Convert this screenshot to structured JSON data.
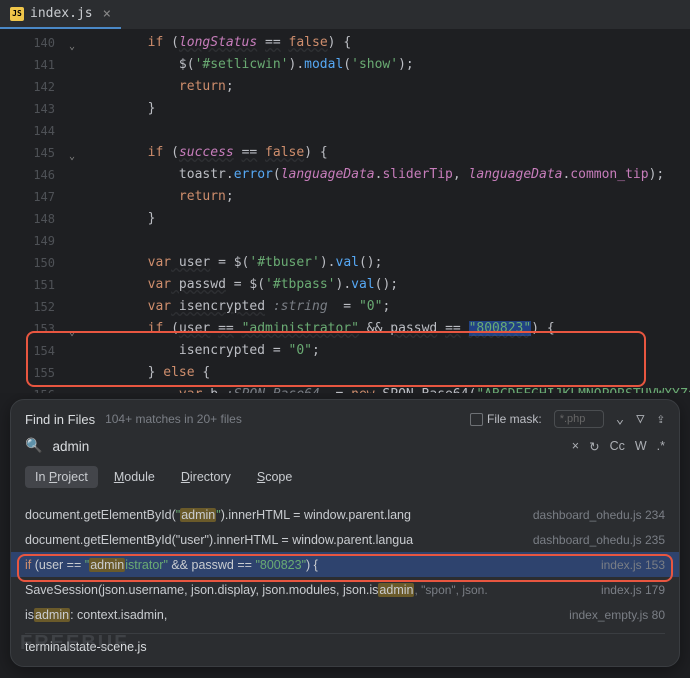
{
  "tab": {
    "icon": "JS",
    "name": "index.js",
    "close": "×"
  },
  "gutter": [
    "140",
    "141",
    "142",
    "143",
    "144",
    "145",
    "146",
    "147",
    "148",
    "149",
    "150",
    "151",
    "152",
    "153",
    "154",
    "155",
    "156"
  ],
  "code": {
    "l140": {
      "pre": "        ",
      "kw": "if",
      "mid": " (",
      "v1": "longStatus",
      "eq": "==",
      "v2": "false",
      "end": ") {"
    },
    "l141": {
      "pre": "            $(",
      "s": "'#setlicwin'",
      "mid": ").",
      "fn": "modal",
      "a": "(",
      "s2": "'show'",
      "end": ");"
    },
    "l142": {
      "pre": "            ",
      "kw": "return",
      "end": ";"
    },
    "l143": "        }",
    "l144": "",
    "l145": {
      "pre": "        ",
      "kw": "if",
      "mid": " (",
      "v1": "success",
      "eq": "==",
      "v2": "false",
      "end": ") {"
    },
    "l146": {
      "pre": "            toastr.",
      "fn": "error",
      "a": "(",
      "p1": "languageData",
      "d": ".",
      "m1": "sliderTip",
      "c": ", ",
      "p2": "languageData",
      "d2": ".",
      "m2": "common_tip",
      "end": ");"
    },
    "l147": {
      "pre": "            ",
      "kw": "return",
      "end": ";"
    },
    "l148": "        }",
    "l149": "",
    "l150": {
      "pre": "        ",
      "kw": "var",
      "v": " user",
      "eq": " = $(",
      "s": "'#tbuser'",
      "m": ").",
      "fn": "val",
      "end": "();"
    },
    "l151": {
      "pre": "        ",
      "kw": "var",
      "v": " passwd",
      "eq": " = $(",
      "s": "'#tbpass'",
      "m": ").",
      "fn": "val",
      "end": "();"
    },
    "l152": {
      "pre": "        ",
      "kw": "var",
      "v": " isencrypted",
      "t": " :string ",
      "eq": " = ",
      "s": "\"0\"",
      "end": ";"
    },
    "l153": {
      "pre": "        ",
      "kw": "if",
      "mid": " (",
      "v1": "user",
      "eq": "==",
      "s1": "\"administrator\"",
      "amp": " && ",
      "v2": "passwd",
      "eq2": "==",
      "s2": "\"800823\"",
      "end": ") {"
    },
    "l154": {
      "pre": "            isencrypted = ",
      "s": "\"0\"",
      "end": ";"
    },
    "l155": {
      "pre": "        } ",
      "kw": "else",
      "end": " {"
    },
    "l156": {
      "pre": "            ",
      "kw": "var",
      "v": " b",
      "t": " :SPON_Base64 ",
      "eq": " = ",
      "nw": "new",
      "cl": " SPON_Base64",
      "a": "(",
      "s": "\"ABCDEFGHIJKLMNOPQRSTUVWXYZa",
      "end": "\"); /"
    }
  },
  "fif": {
    "title": "Find in Files",
    "subtitle": "104+ matches in 20+ files",
    "filemask": "File mask:",
    "filemask_ph": "*.php",
    "search": "admin",
    "cc": "Cc",
    "w": "W",
    "regex": ".*",
    "x": "×",
    "scopes": {
      "inproj_p": "In ",
      "inproj_u": "P",
      "inproj_s": "roject",
      "mod_u": "M",
      "mod_s": "odule",
      "dir_u": "D",
      "dir_s": "irectory",
      "scope_u": "S",
      "scope_s": "cope"
    }
  },
  "results": {
    "r1": {
      "pre": "document.getElementById(",
      "s1": "\"",
      "m": "admin",
      "s2": "\"",
      "post": ").innerHTML = window.parent.lang",
      "loc": "dashboard_ohedu.js 234"
    },
    "r2": {
      "txt": "document.getElementById(\"user\").innerHTML = window.parent.langua",
      "loc": "dashboard_ohedu.js 235"
    },
    "r3": {
      "kw": "if",
      "pre": " (user == ",
      "s1": "\"",
      "m": "admin",
      "mid": "istrator",
      "s2": "\"",
      "amp": " && passwd == ",
      "s3": "\"800823\"",
      "end": ") {",
      "loc": "index.js 153"
    },
    "r4": {
      "pre": "SaveSession(json.username, json.display, json.modules, json.is",
      "m": "admin",
      "post": ", \"spon\", json.",
      "loc": "index.js 179"
    },
    "r5": {
      "pre": "is",
      "m": "admin",
      "post": ": context.isadmin,",
      "loc": "index_empty.js 80"
    },
    "filehdr": "terminalstate-scene.js"
  },
  "watermark": "FREEBUF"
}
